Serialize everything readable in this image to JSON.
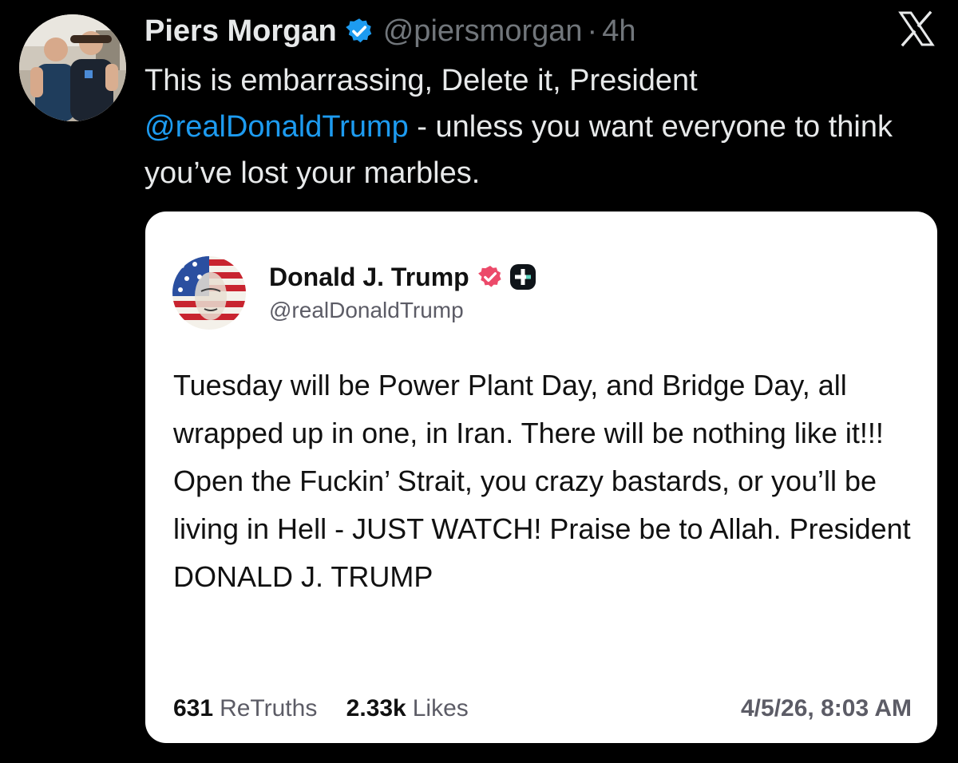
{
  "post": {
    "author_name": "Piers Morgan",
    "author_handle": "@piersmorgan",
    "separator": "·",
    "time": "4h",
    "text_before_mention": "This is embarrassing, Delete it, President ",
    "mention": "@realDonaldTrump",
    "text_after_mention": " - unless you want everyone to think you’ve lost your marbles.",
    "verified_icon": "verified-badge-icon",
    "platform_icon": "x-logo-icon",
    "colors": {
      "background": "#000000",
      "text": "#e7e9ea",
      "muted": "#71767b",
      "link": "#1d9bf0",
      "verified": "#1d9bf0"
    }
  },
  "quoted_post": {
    "author_name": "Donald J. Trump",
    "author_handle": "@realDonaldTrump",
    "verified_icon": "truth-verified-badge-icon",
    "plus_icon": "plus-badge-icon",
    "body": "Tuesday will be Power Plant Day, and Bridge Day, all wrapped up in one, in Iran. There will be nothing like it!!! Open the Fuckin’ Strait, you crazy bastards, or you’ll be living in Hell - JUST WATCH! Praise be to Allah. President DONALD J. TRUMP",
    "retruths_count": "631",
    "retruths_label": "ReTruths",
    "likes_count": "2.33k",
    "likes_label": "Likes",
    "date": "4/5/26, 8:03 AM",
    "colors": {
      "card_background": "#ffffff",
      "badge": "#ec4a6a"
    }
  }
}
